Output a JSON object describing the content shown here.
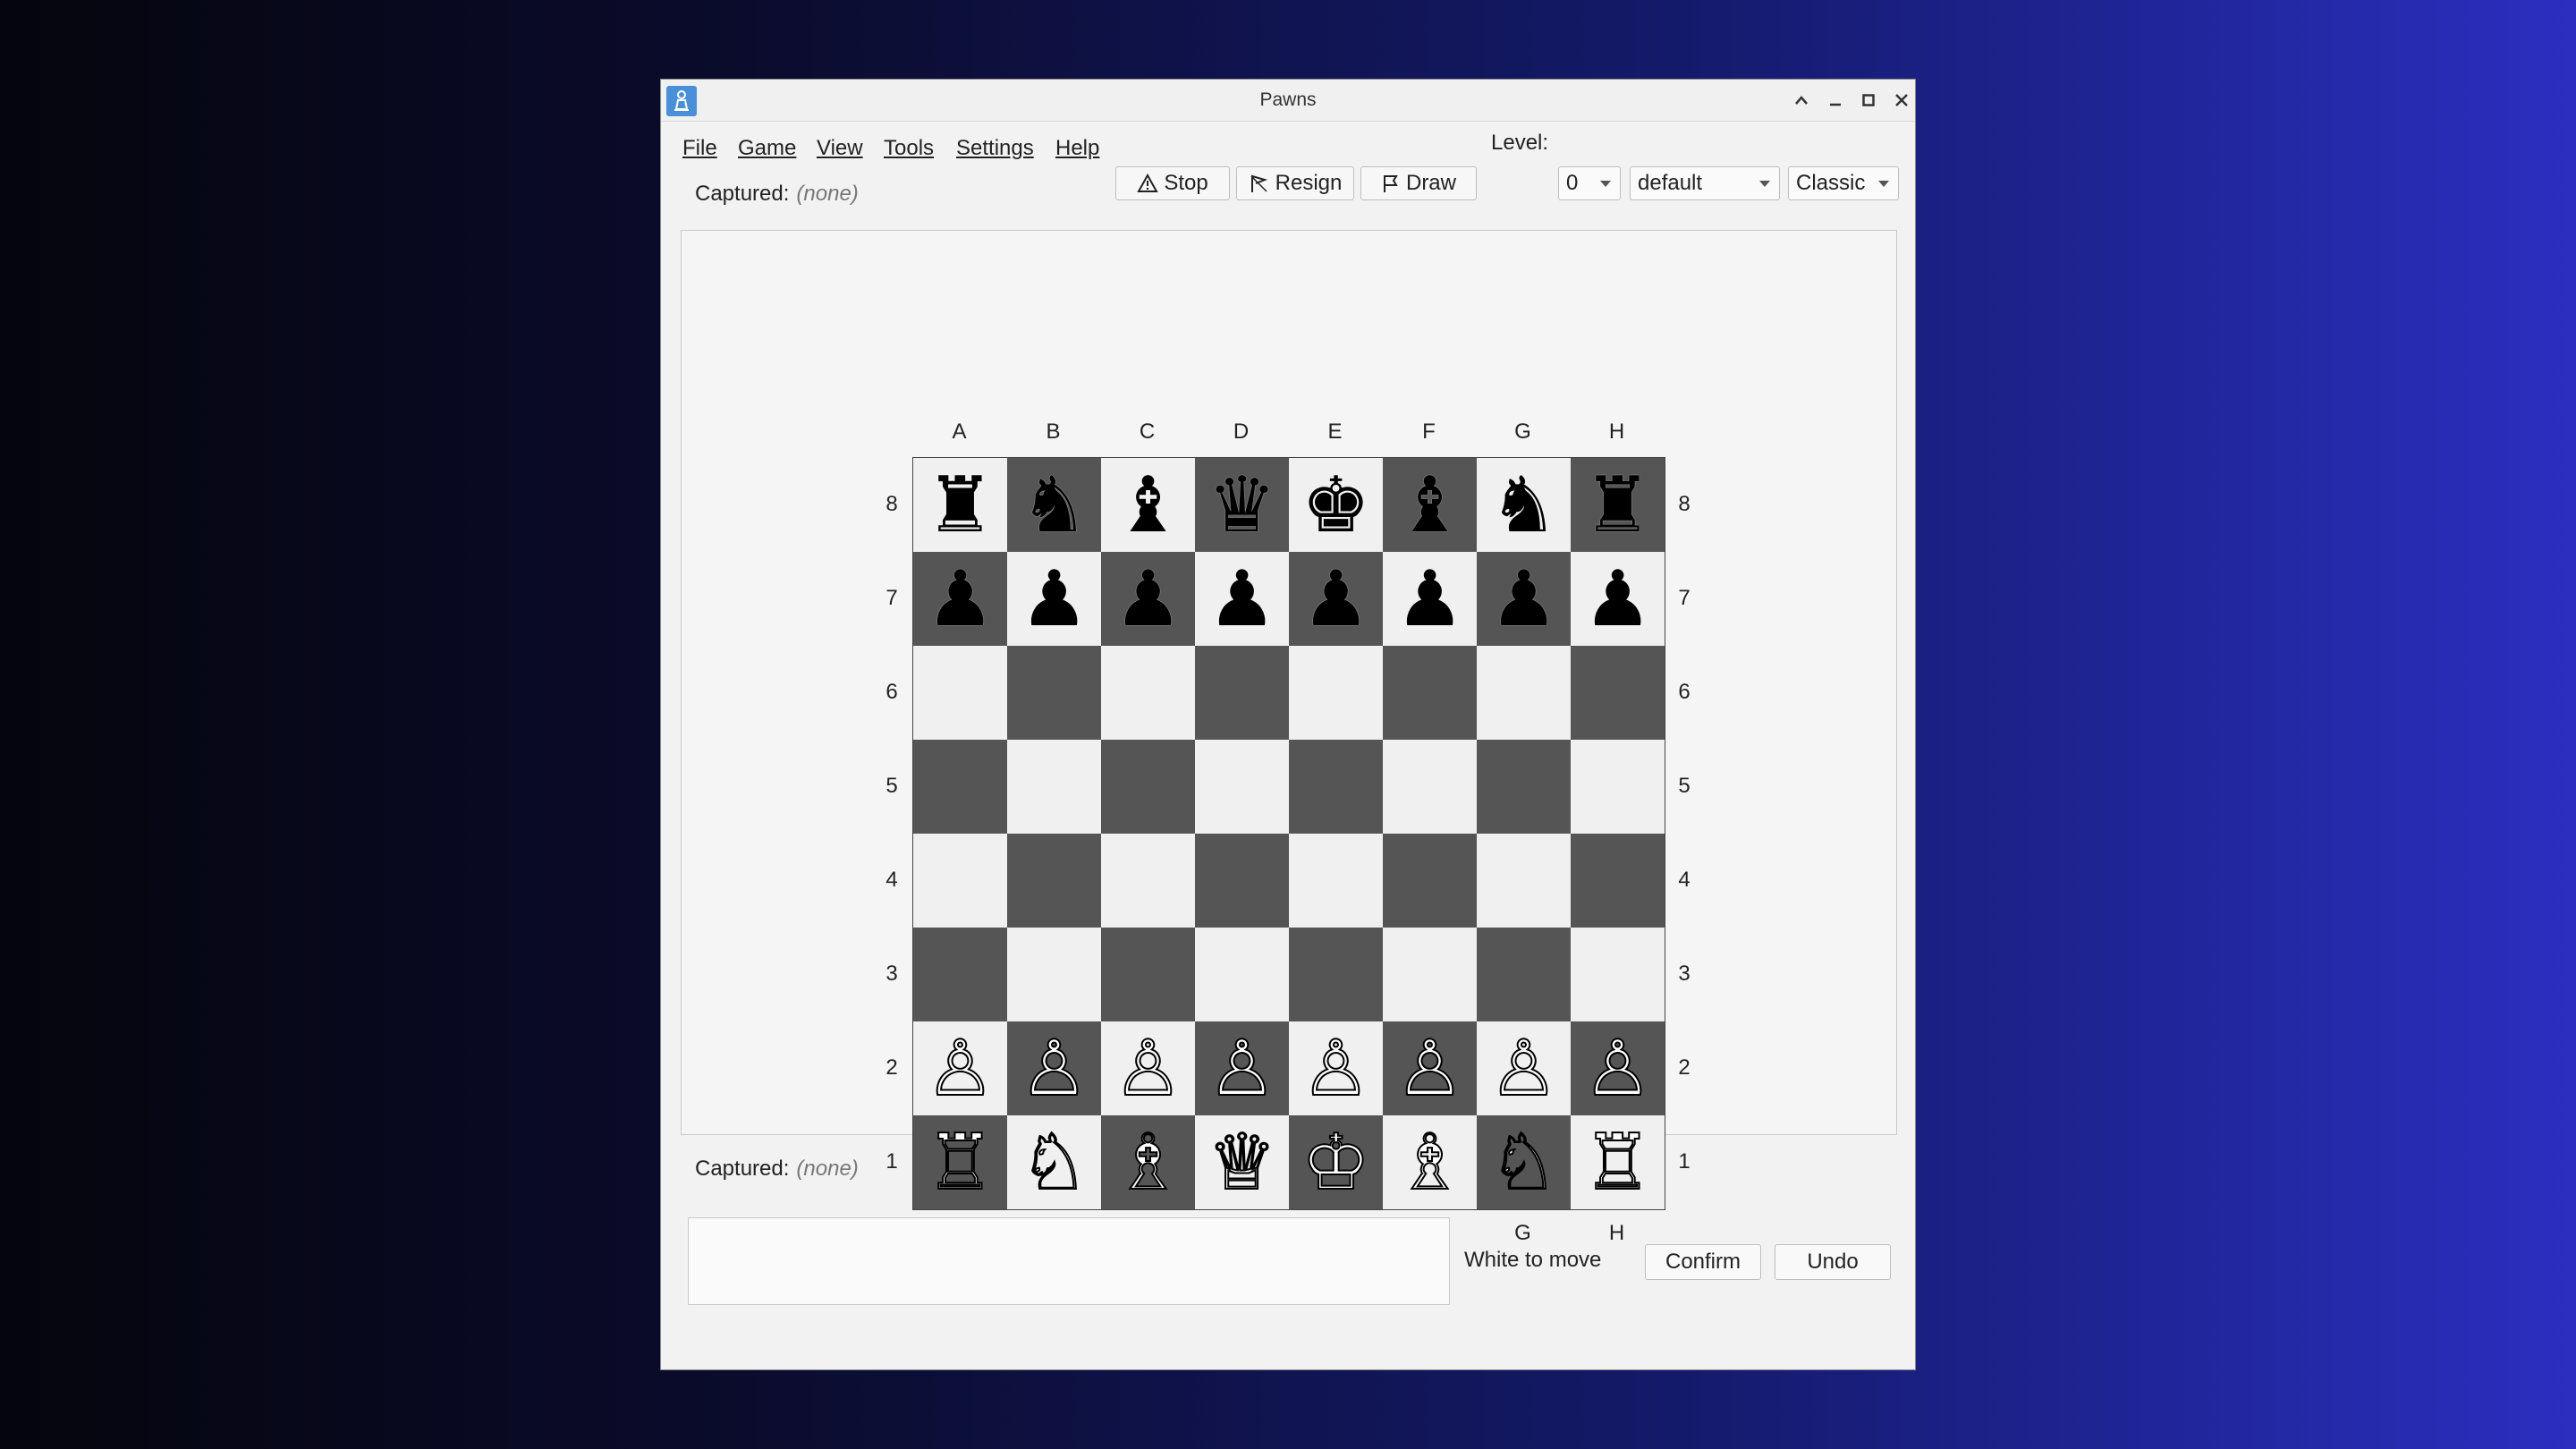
{
  "window": {
    "title": "Pawns"
  },
  "menu": [
    "File",
    "Game",
    "View",
    "Tools",
    "Settings",
    "Help"
  ],
  "toolbar": {
    "stop": "Stop",
    "resign": "Resign",
    "draw": "Draw",
    "level_label": "Level:"
  },
  "selects": {
    "level": "0",
    "engine": "default",
    "theme": "Classic"
  },
  "captured_top": {
    "label": "Captured:",
    "value": "(none)"
  },
  "captured_bottom": {
    "label": "Captured:",
    "value": "(none)"
  },
  "files": [
    "A",
    "B",
    "C",
    "D",
    "E",
    "F",
    "G",
    "H"
  ],
  "ranks": [
    "8",
    "7",
    "6",
    "5",
    "4",
    "3",
    "2",
    "1"
  ],
  "board": [
    [
      "♜",
      "♞",
      "♝",
      "♛",
      "♚",
      "♝",
      "♞",
      "♜"
    ],
    [
      "♟",
      "♟",
      "♟",
      "♟",
      "♟",
      "♟",
      "♟",
      "♟"
    ],
    [
      "",
      "",
      "",
      "",
      "",
      "",
      "",
      ""
    ],
    [
      "",
      "",
      "",
      "",
      "",
      "",
      "",
      ""
    ],
    [
      "",
      "",
      "",
      "",
      "",
      "",
      "",
      ""
    ],
    [
      "",
      "",
      "",
      "",
      "",
      "",
      "",
      ""
    ],
    [
      "♙",
      "♙",
      "♙",
      "♙",
      "♙",
      "♙",
      "♙",
      "♙"
    ],
    [
      "♖",
      "♘",
      "♗",
      "♕",
      "♔",
      "♗",
      "♘",
      "♖"
    ]
  ],
  "move_input": {
    "value": ""
  },
  "status": "White to move",
  "buttons": {
    "confirm": "Confirm",
    "undo": "Undo"
  },
  "colors": {
    "light_square": "#f0f0f0",
    "dark_square": "#555555",
    "app_icon": "#4a90d9"
  }
}
